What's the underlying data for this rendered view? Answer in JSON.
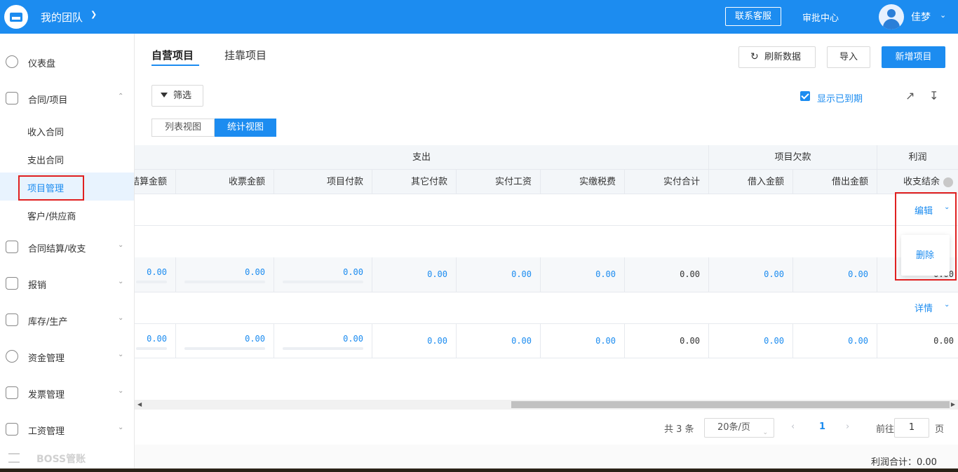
{
  "topbar": {
    "team_name": "我的团队",
    "customer_service": "联系客服",
    "approval_center": "审批中心",
    "user_name": "佳梦"
  },
  "sidebar": {
    "items": [
      {
        "label": "仪表盘",
        "icon": "dashboard-icon"
      },
      {
        "label": "合同/项目",
        "icon": "folder-icon",
        "expanded": true
      },
      {
        "label": "收入合同"
      },
      {
        "label": "支出合同"
      },
      {
        "label": "项目管理",
        "active": true
      },
      {
        "label": "客户/供应商"
      },
      {
        "label": "合同结算/收支",
        "icon": "settlement-icon"
      },
      {
        "label": "报销",
        "icon": "reimburse-icon"
      },
      {
        "label": "库存/生产",
        "icon": "box-icon"
      },
      {
        "label": "资金管理",
        "icon": "money-icon"
      },
      {
        "label": "发票管理",
        "icon": "invoice-icon"
      },
      {
        "label": "工资管理",
        "icon": "salary-icon"
      }
    ],
    "boss": "BOSS管账"
  },
  "main": {
    "tabs": [
      "自营项目",
      "挂靠项目"
    ],
    "refresh": "刷新数据",
    "import": "导入",
    "new_project": "新增项目",
    "filter": "筛选",
    "show_expired": "显示已到期",
    "view_list": "列表视图",
    "view_stats": "统计视图"
  },
  "table": {
    "groups": {
      "expense": "支出",
      "debt": "项目欠款",
      "profit": "利润"
    },
    "columns": [
      "结算金额",
      "收票金额",
      "项目付款",
      "其它付款",
      "实付工资",
      "实缴税费",
      "实付合计",
      "借入金额",
      "借出金额",
      "收支结余"
    ],
    "rows": [
      {
        "values": [
          "0.00",
          "0.00",
          "0.00",
          "0.00",
          "0.00",
          "0.00",
          "0.00",
          "0.00",
          "0.00",
          "0.00"
        ]
      },
      {
        "values": [
          "0.00",
          "0.00",
          "0.00",
          "0.00",
          "0.00",
          "0.00",
          "0.00",
          "0.00",
          "0.00",
          "0.00"
        ]
      }
    ],
    "edit": "编辑",
    "delete": "删除",
    "details": "详情"
  },
  "pager": {
    "total": "共 3 条",
    "page_size": "20条/页",
    "current_page": "1",
    "goto_label": "前往",
    "goto_value": "1",
    "page_suffix": "页"
  },
  "footer": {
    "profit_total": "利润合计：0.00"
  }
}
